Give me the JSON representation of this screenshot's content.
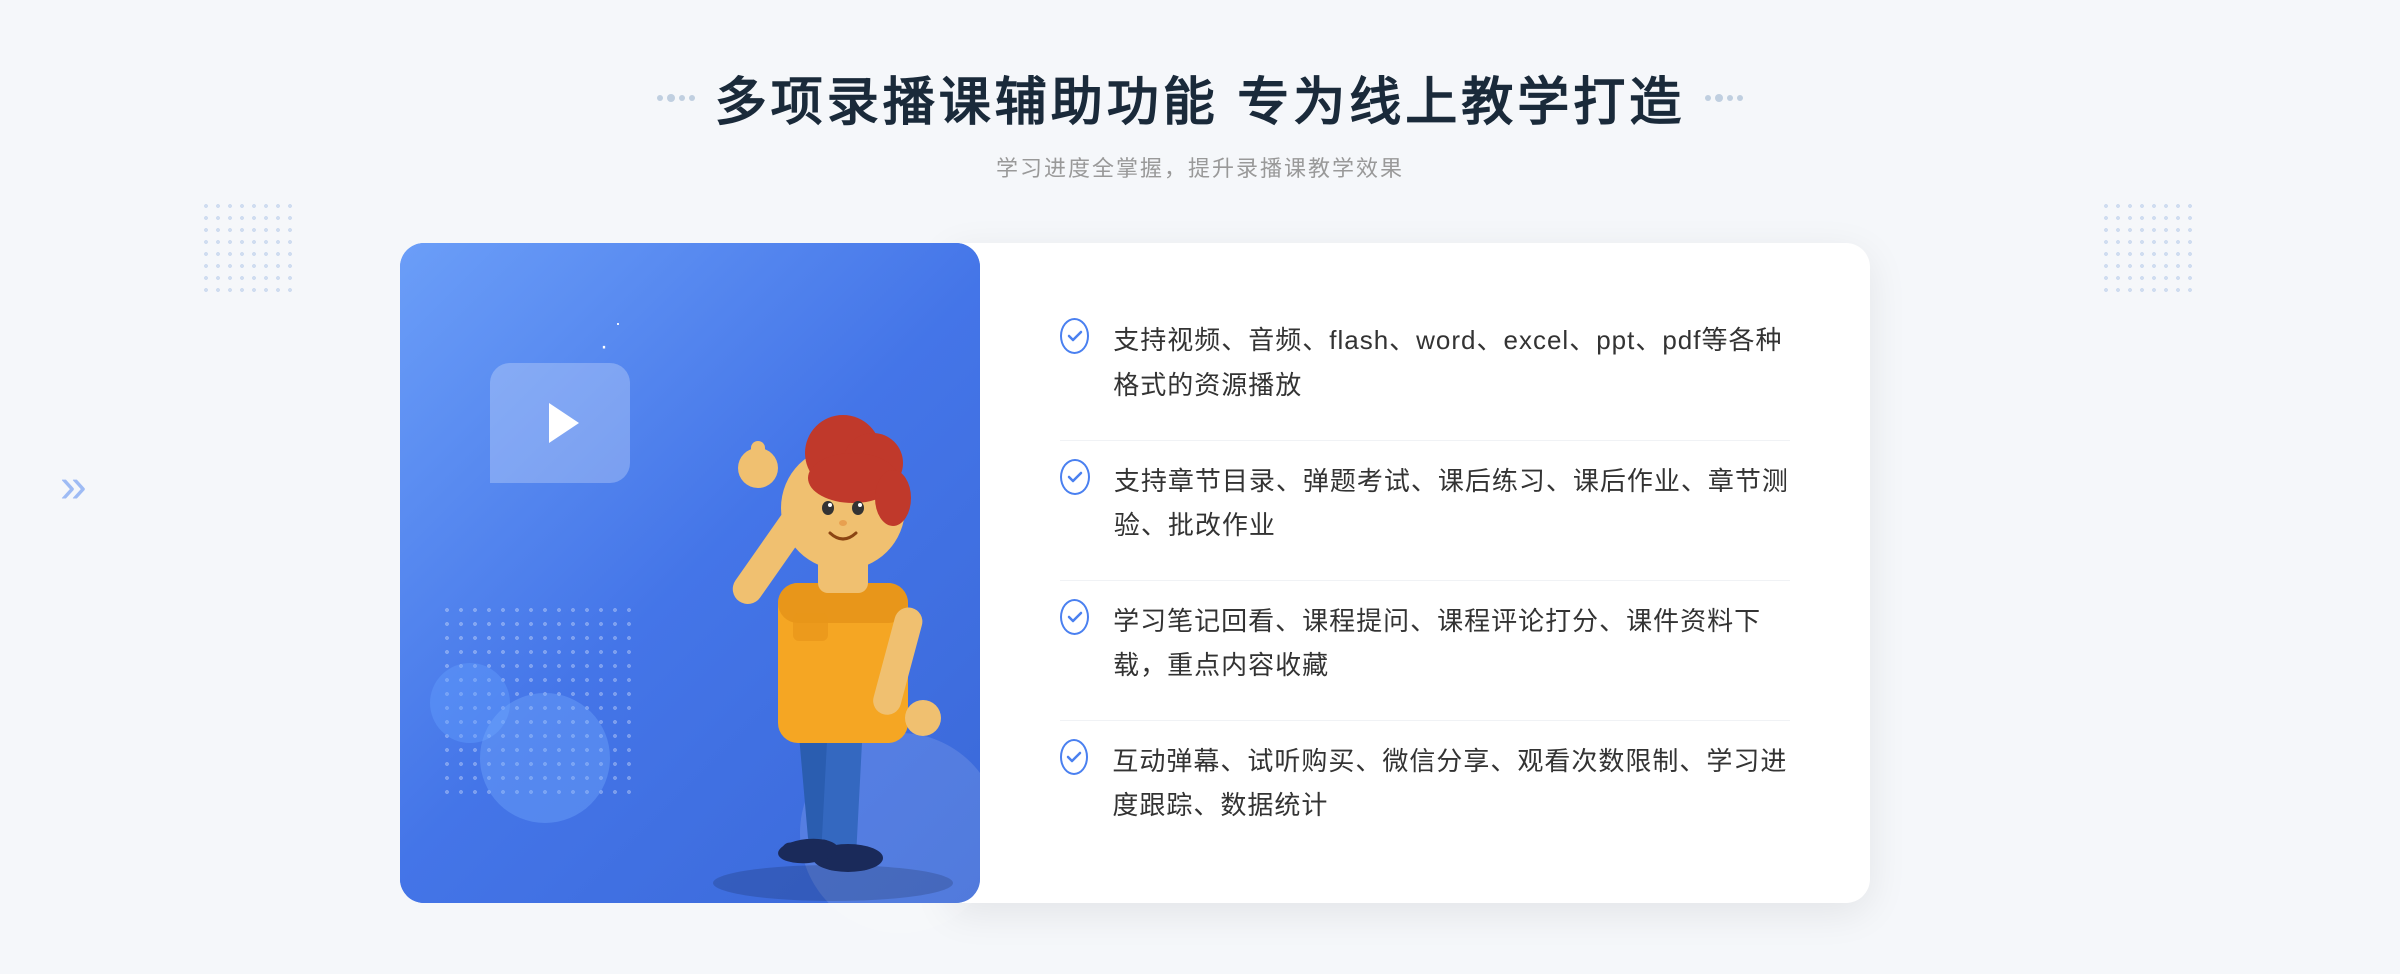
{
  "page": {
    "background_color": "#f5f7fa"
  },
  "header": {
    "main_title": "多项录播课辅助功能 专为线上教学打造",
    "sub_title": "学习进度全掌握，提升录播课教学效果",
    "decorator_left": "❋ ❋",
    "decorator_right": "❋ ❋"
  },
  "features": [
    {
      "id": 1,
      "text": "支持视频、音频、flash、word、excel、ppt、pdf等各种格式的资源播放"
    },
    {
      "id": 2,
      "text": "支持章节目录、弹题考试、课后练习、课后作业、章节测验、批改作业"
    },
    {
      "id": 3,
      "text": "学习笔记回看、课程提问、课程评论打分、课件资料下载，重点内容收藏"
    },
    {
      "id": 4,
      "text": "互动弹幕、试听购买、微信分享、观看次数限制、学习进度跟踪、数据统计"
    }
  ],
  "illustration": {
    "play_button_visible": true
  },
  "decorations": {
    "left_arrow": "»",
    "accent_color": "#4a7ee8"
  }
}
